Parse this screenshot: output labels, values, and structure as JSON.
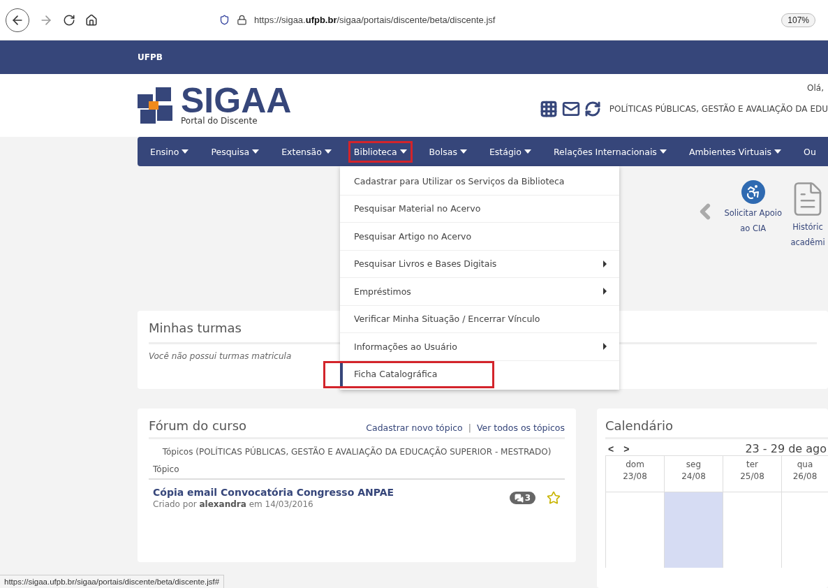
{
  "browser": {
    "url": "https://sigaa.**ufpb.br**/sigaa/portais/discente/beta/discente.jsf",
    "zoom": "107%"
  },
  "top_bar": {
    "title": "UFPB"
  },
  "header": {
    "logo_text": "SIGAA",
    "subtitle": "Portal do Discente",
    "greeting": "Olá,",
    "course": "POLÍTICAS PÚBLICAS, GESTÃO E AVALIAÇÃO DA EDU"
  },
  "nav": [
    {
      "label": "Ensino",
      "caret": true,
      "highlighted": false
    },
    {
      "label": "Pesquisa",
      "caret": true,
      "highlighted": false
    },
    {
      "label": "Extensão",
      "caret": true,
      "highlighted": false
    },
    {
      "label": "Biblioteca",
      "caret": true,
      "highlighted": true
    },
    {
      "label": "Bolsas",
      "caret": true,
      "highlighted": false
    },
    {
      "label": "Estágio",
      "caret": true,
      "highlighted": false
    },
    {
      "label": "Relações Internacionais",
      "caret": true,
      "highlighted": false
    },
    {
      "label": "Ambientes Virtuais",
      "caret": true,
      "highlighted": false
    },
    {
      "label": "Ou",
      "caret": false,
      "highlighted": false
    }
  ],
  "menu": [
    {
      "label": "Cadastrar para Utilizar os Serviços da Biblioteca",
      "submenu": false,
      "highlighted": false
    },
    {
      "label": "Pesquisar Material no Acervo",
      "submenu": false,
      "highlighted": false
    },
    {
      "label": "Pesquisar Artigo no Acervo",
      "submenu": false,
      "highlighted": false
    },
    {
      "label": "Pesquisar Livros e Bases Digitais",
      "submenu": true,
      "highlighted": false
    },
    {
      "label": "Empréstimos",
      "submenu": true,
      "highlighted": false
    },
    {
      "label": "Verificar Minha Situação / Encerrar Vínculo",
      "submenu": false,
      "highlighted": false
    },
    {
      "label": "Informações ao Usuário",
      "submenu": true,
      "highlighted": false
    },
    {
      "label": "Ficha Catalográfica",
      "submenu": false,
      "highlighted": true
    }
  ],
  "shortcuts": [
    {
      "kind": "accessibility",
      "lines": [
        "Solicitar Apoio",
        "ao CIA"
      ]
    },
    {
      "kind": "document",
      "lines": [
        "Históric",
        "acadêmi"
      ]
    }
  ],
  "turmas": {
    "title": "Minhas turmas",
    "message": "Você não possui turmas matricula"
  },
  "forum": {
    "title": "Fórum do curso",
    "links": [
      "Cadastrar novo tópico",
      "Ver todos os tópicos"
    ],
    "separator": "|",
    "caption": "Tópicos (POLÍTICAS PÚBLICAS, GESTÃO E AVALIAÇÃO DA EDUCAÇÃO SUPERIOR - MESTRADO)",
    "column": "Tópico",
    "topics": [
      {
        "title": "Cópia email Convocatória Congresso ANPAE",
        "meta": "Criado por **alexandra** em 14/03/2016",
        "replies": "3",
        "starred": false
      }
    ]
  },
  "calendar": {
    "title": "Calendário",
    "prev": "<",
    "next": ">",
    "range": "23 - 29 de ago",
    "days": [
      {
        "label": "dom 23/08",
        "today": false
      },
      {
        "label": "seg 24/08",
        "today": true
      },
      {
        "label": "ter 25/08",
        "today": false
      },
      {
        "label": "qua 26/08",
        "today": false
      }
    ]
  },
  "status_bar": {
    "url": "https://sigaa.ufpb.br/sigaa/portais/discente/beta/discente.jsf#"
  }
}
